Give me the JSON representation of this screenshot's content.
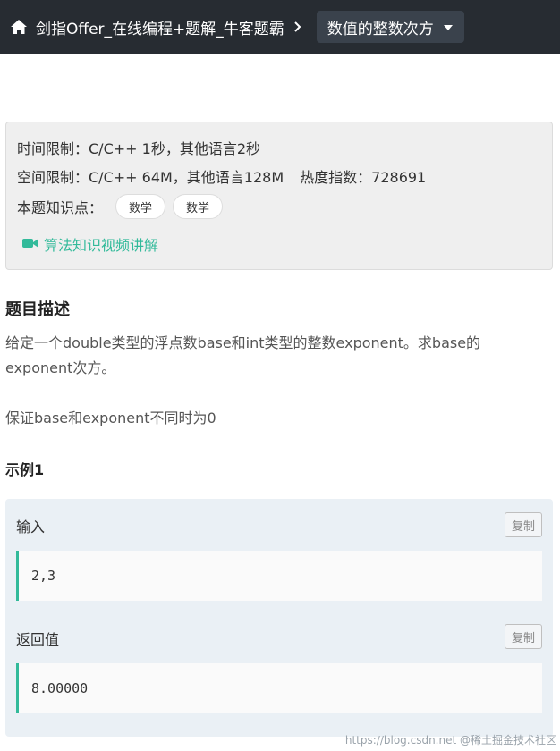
{
  "nav": {
    "home_icon": "home-icon",
    "breadcrumb_link": "剑指Offer_在线编程+题解_牛客题霸",
    "separator_icon": "chevron-right-icon",
    "current_title": "数值的整数次方",
    "dropdown_icon": "caret-down-icon"
  },
  "info": {
    "time_limit": "时间限制：C/C++ 1秒，其他语言2秒",
    "space_limit": "空间限制：C/C++ 64M，其他语言128M",
    "heat": "热度指数：728691",
    "knowledge_label": "本题知识点：",
    "tags": [
      "数学",
      "数学"
    ],
    "video_link": "算法知识视频讲解",
    "video_icon": "video-camera-icon",
    "accent_color": "#32ba9a"
  },
  "description": {
    "title": "题目描述",
    "paragraph1": "给定一个double类型的浮点数base和int类型的整数exponent。求base的exponent次方。",
    "paragraph2": "保证base和exponent不同时为0"
  },
  "example": {
    "title": "示例1",
    "input_label": "输入",
    "input_value": "2,3",
    "output_label": "返回值",
    "output_value": "8.00000",
    "copy_label": "复制"
  },
  "watermark": "https://blog.csdn.net @稀土掘金技术社区"
}
